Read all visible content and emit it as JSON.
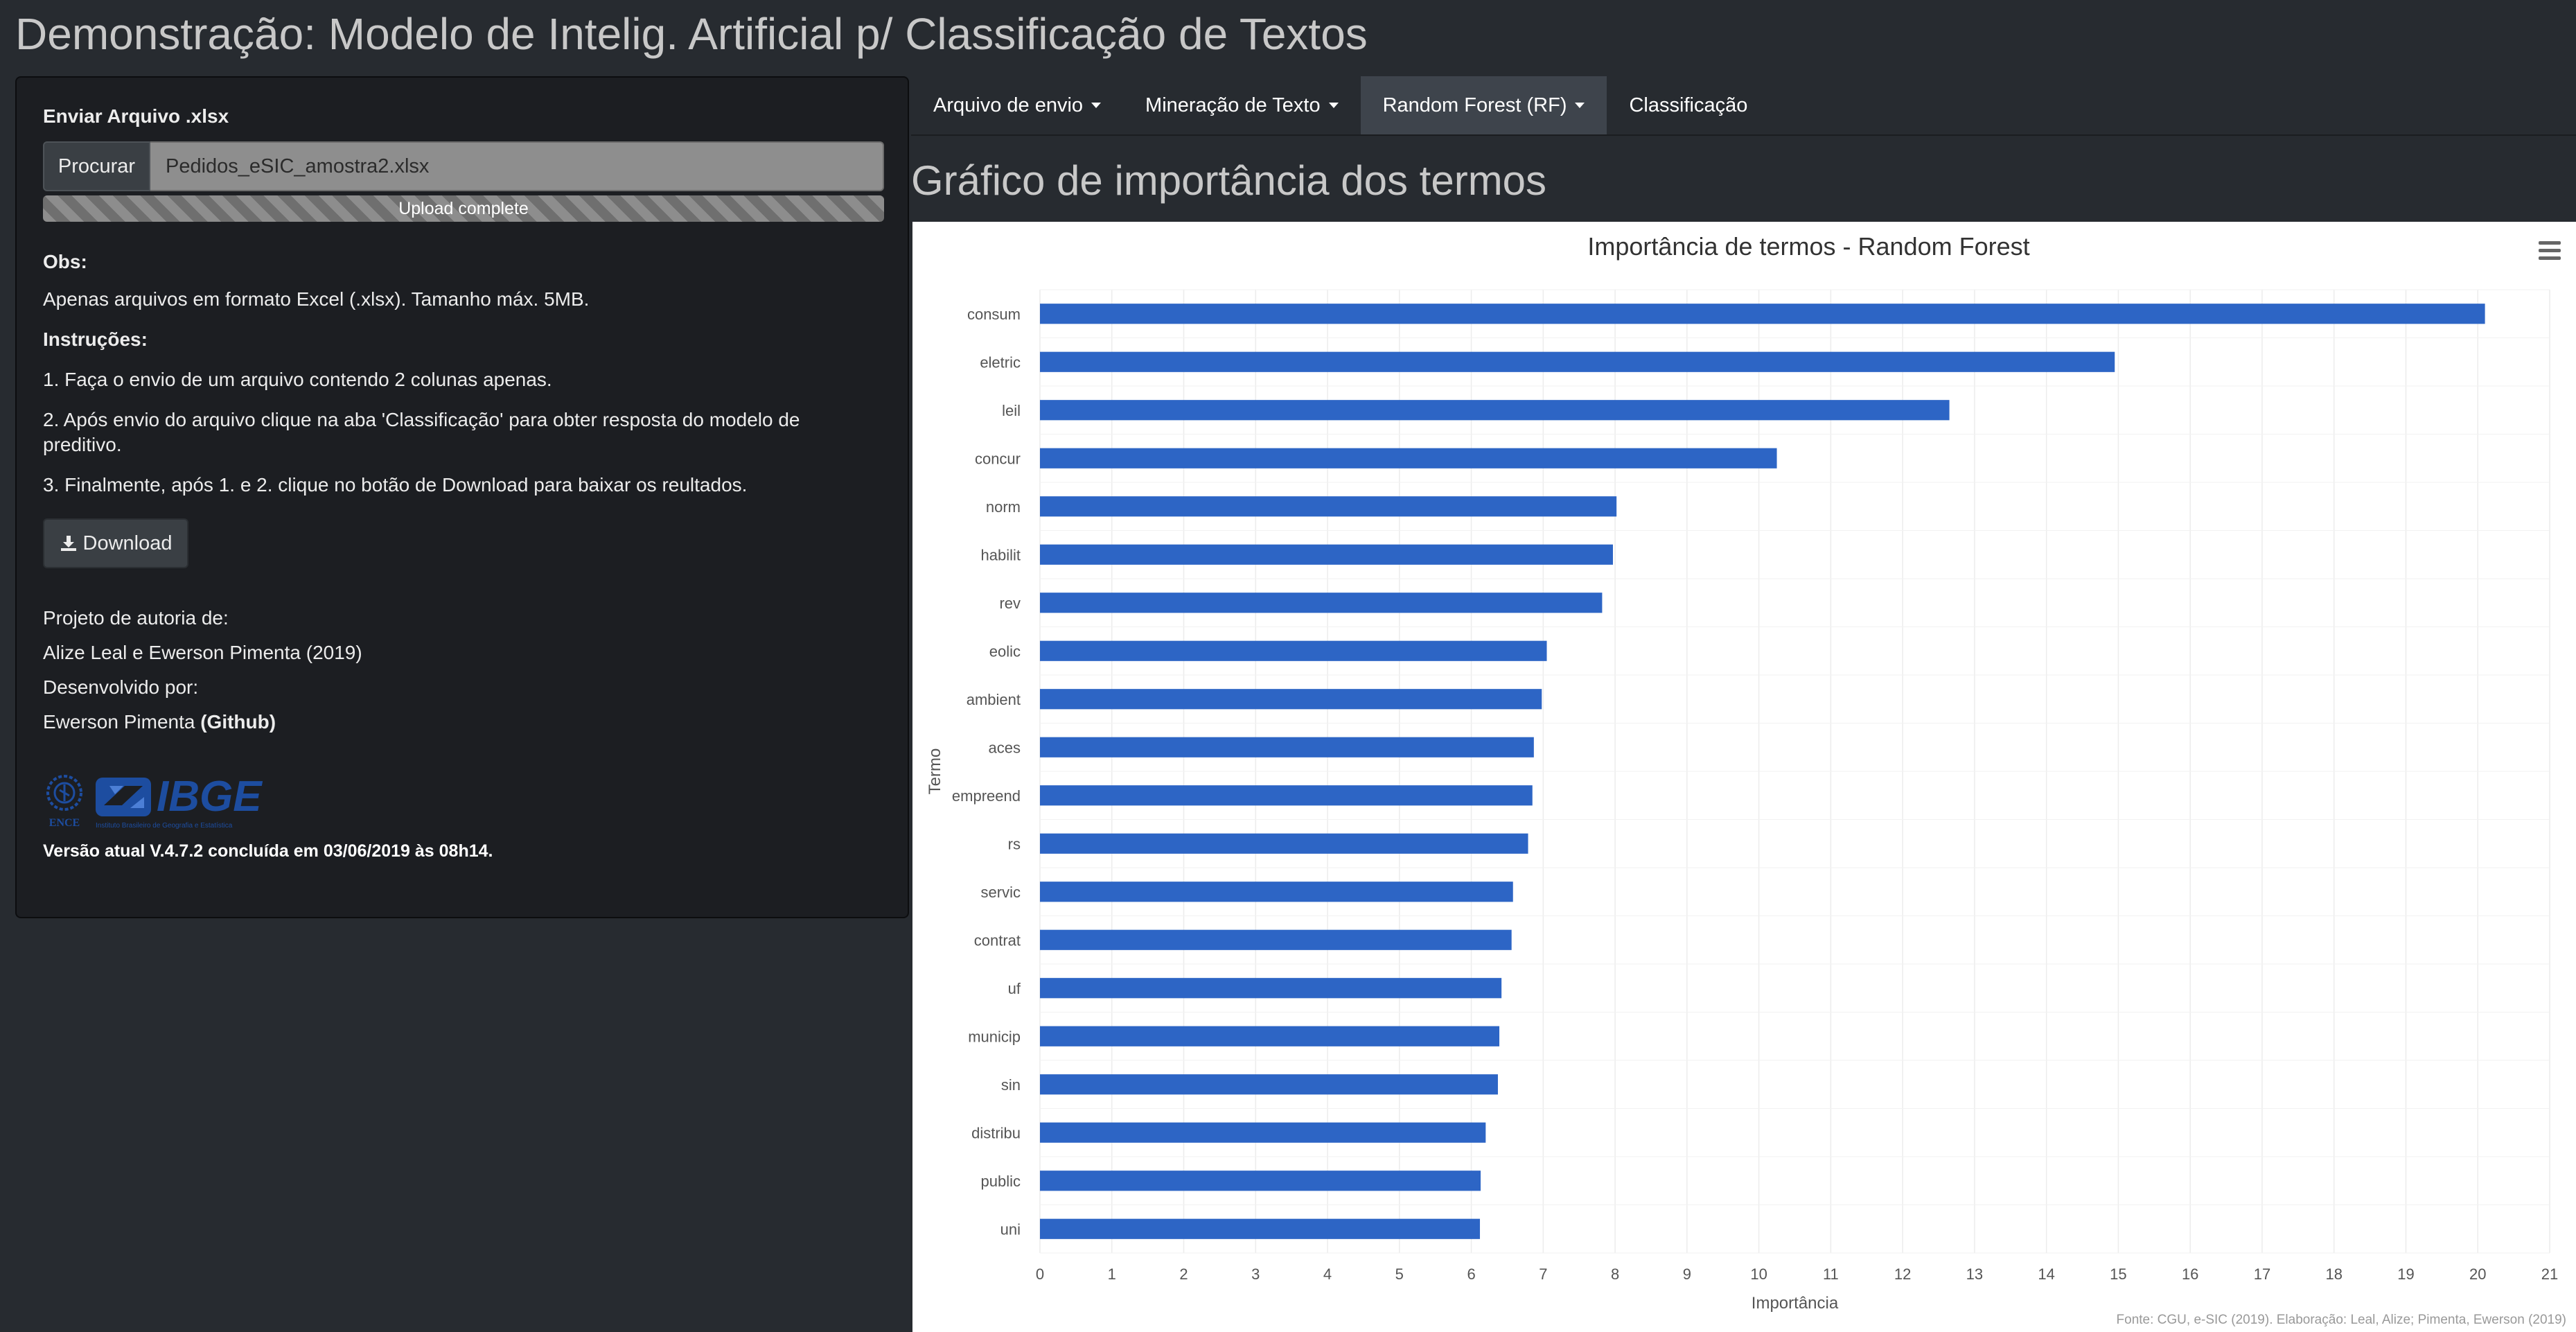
{
  "app": {
    "title": "Demonstração: Modelo de Intelig. Artificial p/ Classificação de Textos"
  },
  "sidebar": {
    "upload_label": "Enviar Arquivo .xlsx",
    "browse_label": "Procurar",
    "file_name": "Pedidos_eSIC_amostra2.xlsx",
    "progress_text": "Upload complete",
    "progress_value": 1.0,
    "obs_title": "Obs:",
    "obs_text": "Apenas arquivos em formato Excel (.xlsx). Tamanho máx. 5MB.",
    "instructions_title": "Instruções:",
    "instructions": [
      "1. Faça o envio de um arquivo contendo 2 colunas apenas.",
      "2. Após envio do arquivo clique na aba 'Classificação' para obter resposta do modelo de preditivo.",
      "3. Finalmente, após 1. e 2. clique no botão de Download para baixar os reultados."
    ],
    "download_label": "Download",
    "authorship_label": "Projeto de autoria de:",
    "authors": "Alize Leal e Ewerson Pimenta (2019)",
    "developed_label": "Desenvolvido por:",
    "developer": "Ewerson Pimenta",
    "github": "(Github)",
    "logo_ence": "ENCE",
    "logo_ibge": "IBGE",
    "logo_ibge_sub": "Instituto Brasileiro de Geografia e Estatística",
    "version": "Versão atual V.4.7.2 concluída em 03/06/2019 às 08h14."
  },
  "nav": {
    "tabs": [
      {
        "label": "Arquivo de envio",
        "dropdown": true,
        "active": false
      },
      {
        "label": "Mineração de Texto",
        "dropdown": true,
        "active": false
      },
      {
        "label": "Random Forest (RF)",
        "dropdown": true,
        "active": true
      },
      {
        "label": "Classificação",
        "dropdown": false,
        "active": false
      }
    ]
  },
  "main": {
    "section_title": "Gráfico de importância dos termos"
  },
  "colors": {
    "bar": "#2d65c5",
    "page_bg": "#272b30",
    "sidebar_bg": "#1c1e22",
    "active_tab": "#3e444c"
  },
  "chart_data": {
    "type": "bar",
    "orientation": "horizontal",
    "title": "Importância de termos - Random Forest",
    "xlabel": "Importância",
    "ylabel": "Termo",
    "credits": "Fonte: CGU, e-SIC (2019). Elaboração: Leal, Alize; Pimenta, Ewerson (2019)",
    "xlim": [
      0,
      21
    ],
    "xticks": [
      0,
      1,
      2,
      3,
      4,
      5,
      6,
      7,
      8,
      9,
      10,
      11,
      12,
      13,
      14,
      15,
      16,
      17,
      18,
      19,
      20,
      21
    ],
    "grid": true,
    "categories": [
      "consum",
      "eletric",
      "leil",
      "concur",
      "norm",
      "habilit",
      "rev",
      "eolic",
      "ambient",
      "aces",
      "empreend",
      "rs",
      "servic",
      "contrat",
      "uf",
      "municip",
      "sin",
      "distribu",
      "public",
      "uni"
    ],
    "values": [
      20.1,
      14.95,
      12.65,
      10.25,
      8.02,
      7.97,
      7.82,
      7.05,
      6.98,
      6.87,
      6.85,
      6.79,
      6.58,
      6.56,
      6.42,
      6.39,
      6.37,
      6.2,
      6.13,
      6.12
    ]
  }
}
